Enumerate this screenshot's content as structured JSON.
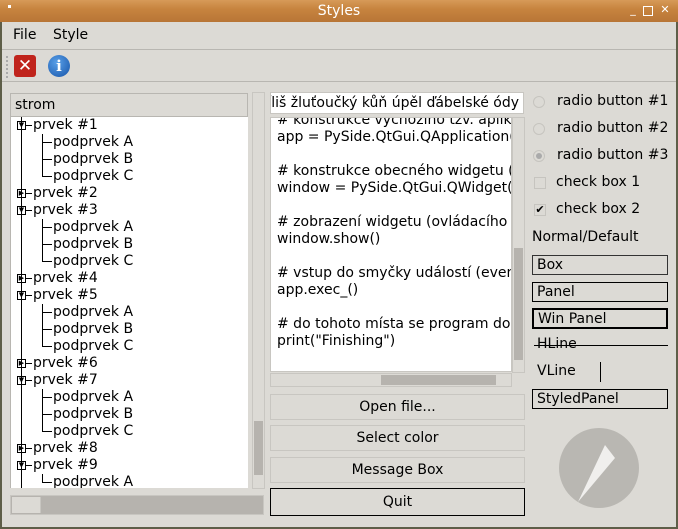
{
  "window": {
    "title": "Styles"
  },
  "menu": [
    "File",
    "Style"
  ],
  "toolbar": {
    "icons": [
      "close-red-icon",
      "info-icon"
    ]
  },
  "tree": {
    "header": "strom",
    "items": [
      {
        "label": "prvek #1",
        "expanded": true,
        "children": [
          "podprvek A",
          "podprvek B",
          "podprvek C"
        ]
      },
      {
        "label": "prvek #2",
        "expanded": false,
        "children": []
      },
      {
        "label": "prvek #3",
        "expanded": true,
        "children": [
          "podprvek A",
          "podprvek B",
          "podprvek C"
        ]
      },
      {
        "label": "prvek #4",
        "expanded": false,
        "children": []
      },
      {
        "label": "prvek #5",
        "expanded": true,
        "children": [
          "podprvek A",
          "podprvek B",
          "podprvek C"
        ]
      },
      {
        "label": "prvek #6",
        "expanded": false,
        "children": []
      },
      {
        "label": "prvek #7",
        "expanded": true,
        "children": [
          "podprvek A",
          "podprvek B",
          "podprvek C"
        ]
      },
      {
        "label": "prvek #8",
        "expanded": false,
        "children": []
      },
      {
        "label": "prvek #9",
        "expanded": true,
        "children": [
          "podprvek A"
        ]
      }
    ]
  },
  "line_edit": {
    "value": "příliš žluťoučký kůň úpěl ďábelské ódy"
  },
  "text_edit": {
    "lines": [
      "# konstrukce výchozího tzv. aplikace",
      "app = PySide.QtGui.QApplication(sys.argv)",
      "",
      "# konstrukce obecného widgetu (okna)",
      "window = PySide.QtGui.QWidget()",
      "",
      "# zobrazení widgetu (ovládacího prvku)",
      "window.show()",
      "",
      "# vstup do smyčky událostí (event loop)",
      "app.exec_()",
      "",
      "# do tohoto místa se program dostane",
      "print(\"Finishing\")"
    ]
  },
  "buttons": [
    "Open file...",
    "Select color",
    "Message Box",
    "Quit"
  ],
  "radios": [
    {
      "label": "radio button #1",
      "checked": false
    },
    {
      "label": "radio button #2",
      "checked": false
    },
    {
      "label": "radio button #3",
      "checked": true
    }
  ],
  "checks": [
    {
      "label": "check box 1",
      "checked": false
    },
    {
      "label": "check box 2",
      "checked": true
    }
  ],
  "frames": {
    "normal": "Normal/Default",
    "box": "Box",
    "panel": "Panel",
    "winpanel": "Win Panel",
    "hline": "HLine",
    "vline": "VLine",
    "styled": "StyledPanel"
  }
}
